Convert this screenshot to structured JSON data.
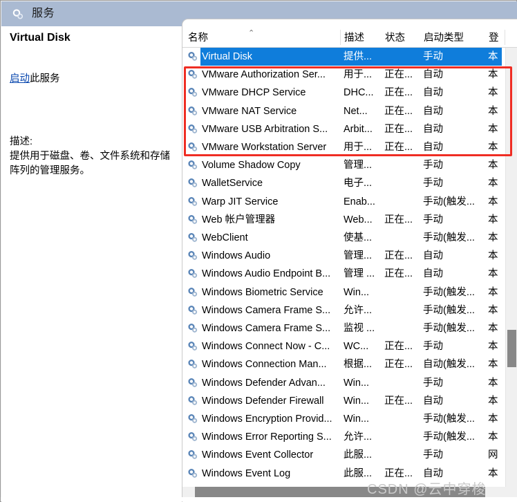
{
  "window": {
    "title": "服务",
    "icon": "services-gear-icon"
  },
  "detail_pane": {
    "service_name": "Virtual Disk",
    "action_link": "启动",
    "action_suffix": "此服务",
    "description_label": "描述:",
    "description_text": "提供用于磁盘、卷、文件系统和存储阵列的管理服务。"
  },
  "list": {
    "sort_caret": "⌃",
    "columns": [
      {
        "label": "名称",
        "key": "name"
      },
      {
        "label": "描述",
        "key": "desc"
      },
      {
        "label": "状态",
        "key": "state"
      },
      {
        "label": "启动类型",
        "key": "start"
      },
      {
        "label": "登",
        "key": "logon"
      }
    ],
    "rows": [
      {
        "name": "Virtual Disk",
        "desc": "提供...",
        "state": "",
        "start": "手动",
        "logon": "本",
        "selected": true,
        "highlighted": false
      },
      {
        "name": "VMware Authorization Ser...",
        "desc": "用于...",
        "state": "正在...",
        "start": "自动",
        "logon": "本",
        "selected": false,
        "highlighted": true
      },
      {
        "name": "VMware DHCP Service",
        "desc": "DHC...",
        "state": "正在...",
        "start": "自动",
        "logon": "本",
        "selected": false,
        "highlighted": true
      },
      {
        "name": "VMware NAT Service",
        "desc": "Net...",
        "state": "正在...",
        "start": "自动",
        "logon": "本",
        "selected": false,
        "highlighted": true
      },
      {
        "name": "VMware USB Arbitration S...",
        "desc": "Arbit...",
        "state": "正在...",
        "start": "自动",
        "logon": "本",
        "selected": false,
        "highlighted": true
      },
      {
        "name": "VMware Workstation Server",
        "desc": "用于...",
        "state": "正在...",
        "start": "自动",
        "logon": "本",
        "selected": false,
        "highlighted": true
      },
      {
        "name": "Volume Shadow Copy",
        "desc": "管理...",
        "state": "",
        "start": "手动",
        "logon": "本",
        "selected": false,
        "highlighted": false
      },
      {
        "name": "WalletService",
        "desc": "电子...",
        "state": "",
        "start": "手动",
        "logon": "本",
        "selected": false,
        "highlighted": false
      },
      {
        "name": "Warp JIT Service",
        "desc": "Enab...",
        "state": "",
        "start": "手动(触发...",
        "logon": "本",
        "selected": false,
        "highlighted": false
      },
      {
        "name": "Web 帐户管理器",
        "desc": "Web...",
        "state": "正在...",
        "start": "手动",
        "logon": "本",
        "selected": false,
        "highlighted": false
      },
      {
        "name": "WebClient",
        "desc": "使基...",
        "state": "",
        "start": "手动(触发...",
        "logon": "本",
        "selected": false,
        "highlighted": false
      },
      {
        "name": "Windows Audio",
        "desc": "管理...",
        "state": "正在...",
        "start": "自动",
        "logon": "本",
        "selected": false,
        "highlighted": false
      },
      {
        "name": "Windows Audio Endpoint B...",
        "desc": "管理 ...",
        "state": "正在...",
        "start": "自动",
        "logon": "本",
        "selected": false,
        "highlighted": false
      },
      {
        "name": "Windows Biometric Service",
        "desc": "Win...",
        "state": "",
        "start": "手动(触发...",
        "logon": "本",
        "selected": false,
        "highlighted": false
      },
      {
        "name": "Windows Camera Frame S...",
        "desc": "允许...",
        "state": "",
        "start": "手动(触发...",
        "logon": "本",
        "selected": false,
        "highlighted": false
      },
      {
        "name": "Windows Camera Frame S...",
        "desc": "监视 ...",
        "state": "",
        "start": "手动(触发...",
        "logon": "本",
        "selected": false,
        "highlighted": false
      },
      {
        "name": "Windows Connect Now - C...",
        "desc": "WC...",
        "state": "正在...",
        "start": "手动",
        "logon": "本",
        "selected": false,
        "highlighted": false
      },
      {
        "name": "Windows Connection Man...",
        "desc": "根据...",
        "state": "正在...",
        "start": "自动(触发...",
        "logon": "本",
        "selected": false,
        "highlighted": false
      },
      {
        "name": "Windows Defender Advan...",
        "desc": "Win...",
        "state": "",
        "start": "手动",
        "logon": "本",
        "selected": false,
        "highlighted": false
      },
      {
        "name": "Windows Defender Firewall",
        "desc": "Win...",
        "state": "正在...",
        "start": "自动",
        "logon": "本",
        "selected": false,
        "highlighted": false
      },
      {
        "name": "Windows Encryption Provid...",
        "desc": "Win...",
        "state": "",
        "start": "手动(触发...",
        "logon": "本",
        "selected": false,
        "highlighted": false
      },
      {
        "name": "Windows Error Reporting S...",
        "desc": "允许...",
        "state": "",
        "start": "手动(触发...",
        "logon": "本",
        "selected": false,
        "highlighted": false
      },
      {
        "name": "Windows Event Collector",
        "desc": "此服...",
        "state": "",
        "start": "手动",
        "logon": "网",
        "selected": false,
        "highlighted": false
      },
      {
        "name": "Windows Event Log",
        "desc": "此服...",
        "state": "正在...",
        "start": "自动",
        "logon": "本",
        "selected": false,
        "highlighted": false
      }
    ]
  },
  "annotation": {
    "highlight_color": "#ef2d23"
  },
  "watermark": {
    "text": "CSDN @云中穿梭"
  }
}
